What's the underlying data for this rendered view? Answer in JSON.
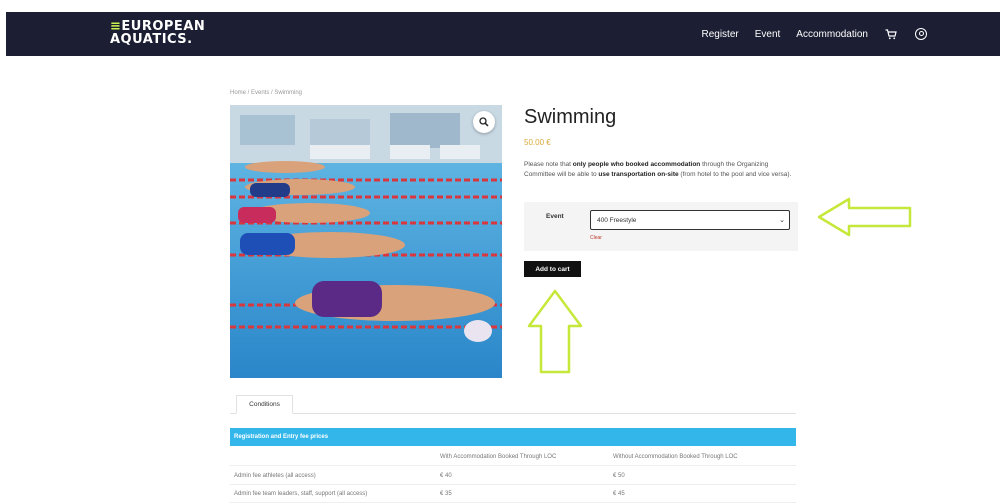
{
  "header": {
    "logo_line1": "EUROPEAN",
    "logo_line2": "AQUATICS.",
    "nav": [
      "Register",
      "Event",
      "Accommodation"
    ],
    "icons": [
      "cart-icon",
      "user-icon"
    ]
  },
  "breadcrumb": "Home / Events / Swimming",
  "product": {
    "title": "Swimming",
    "price": "50.00 €",
    "note_before1": "Please note that ",
    "note_bold1": "only people who booked accommodation",
    "note_between": " through the Organizing Committee will be able to ",
    "note_bold2": "use transportation on-site",
    "note_after": " (from hotel to the pool and vice versa).",
    "event_label": "Event",
    "event_selected": "400 Freestyle",
    "clear_label": "Clear",
    "add_to_cart": "Add to cart"
  },
  "tabs": [
    "Conditions"
  ],
  "table": {
    "title": "Registration and Entry fee prices",
    "columns": [
      "",
      "With Accommodation Booked Through LOC",
      "Without Accommodation Booked Through LOC"
    ],
    "rows": [
      [
        "Admin fee athletes (all access)",
        "€ 40",
        "€ 50"
      ],
      [
        "Admin fee team leaders, staff, support (all access)",
        "€ 35",
        "€ 45"
      ]
    ]
  },
  "colors": {
    "header_bg": "#1c1e33",
    "logo_accent": "#c6f24e",
    "price": "#d8a93b",
    "annotation_arrow": "#c6e83a",
    "table_header": "#33b6ea"
  }
}
